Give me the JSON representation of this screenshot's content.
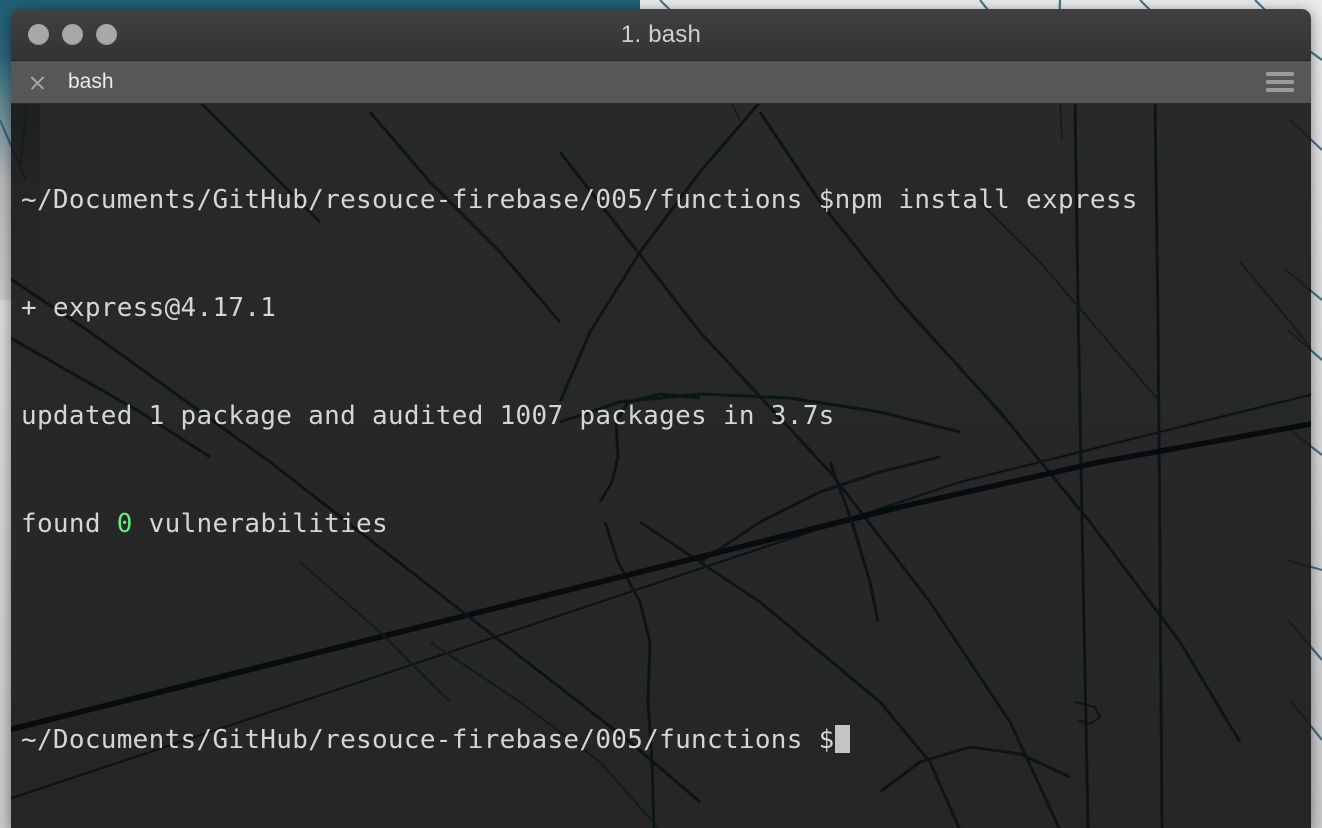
{
  "desktop": {
    "background_description": "light gray street map",
    "map_line_color": "#2d5f75",
    "accent_teal": "#225e74"
  },
  "window": {
    "title": "1. bash",
    "traffic_lights": [
      {
        "name": "close",
        "color": "#a8a8a8"
      },
      {
        "name": "minimize",
        "color": "#a8a8a8"
      },
      {
        "name": "maximize",
        "color": "#a8a8a8"
      }
    ],
    "titlebar_color": "#3a3a3a"
  },
  "tabbar": {
    "tab_label": "bash",
    "close_icon": "close-icon",
    "menu_icon": "hamburger-menu-icon",
    "background_color": "#575757"
  },
  "terminal": {
    "background_color": "#141414",
    "foreground_color": "#d5d5d5",
    "success_color": "#5ef07c",
    "cursor_color": "#c4c4c4",
    "font_size_px": 26,
    "lines": [
      {
        "id": "line-command",
        "segments": [
          {
            "text": "~/Documents/GitHub/resouce-firebase/005/functions $npm install express",
            "color": "default"
          }
        ]
      },
      {
        "id": "line-installed",
        "segments": [
          {
            "text": "+ express@4.17.1",
            "color": "default"
          }
        ]
      },
      {
        "id": "line-updated",
        "segments": [
          {
            "text": "updated 1 package and audited 1007 packages in 3.7s",
            "color": "default"
          }
        ]
      },
      {
        "id": "line-vulns",
        "segments": [
          {
            "text": "found ",
            "color": "default"
          },
          {
            "text": "0",
            "color": "green"
          },
          {
            "text": " vulnerabilities",
            "color": "default"
          }
        ]
      },
      {
        "id": "line-blank",
        "segments": [
          {
            "text": "",
            "color": "default"
          }
        ]
      },
      {
        "id": "line-prompt",
        "segments": [
          {
            "text": "~/Documents/GitHub/resouce-firebase/005/functions $",
            "color": "default"
          },
          {
            "text": "",
            "color": "cursor"
          }
        ]
      }
    ],
    "prompt_text": "~/Documents/GitHub/resouce-firebase/005/functions $",
    "command_text": "npm install express"
  }
}
